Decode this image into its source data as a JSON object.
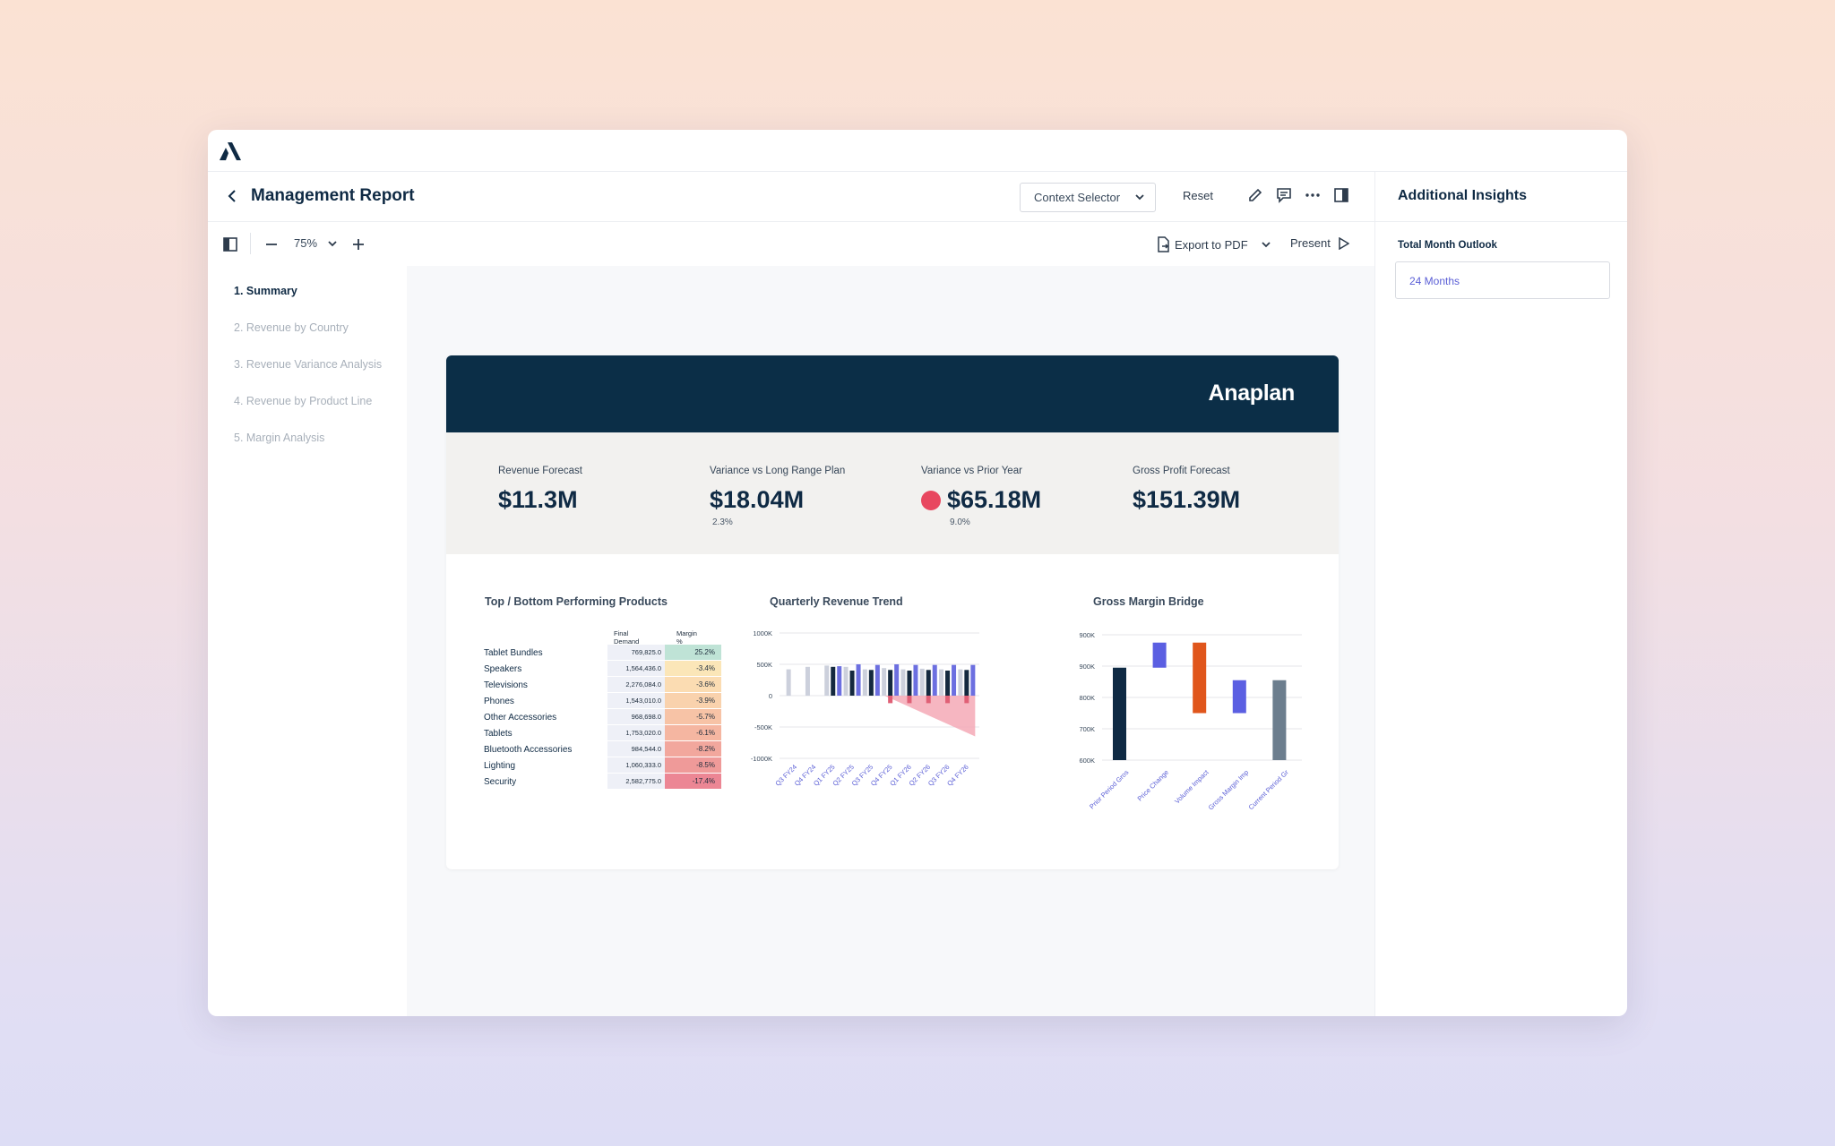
{
  "app": {
    "title": "Management Report"
  },
  "header": {
    "context_selector": "Context Selector",
    "reset": "Reset"
  },
  "toolbar": {
    "zoom": "75%",
    "export": "Export to PDF",
    "present": "Present"
  },
  "nav": {
    "items": [
      {
        "label": "1. Summary",
        "active": true
      },
      {
        "label": "2. Revenue by Country",
        "active": false
      },
      {
        "label": "3. Revenue Variance Analysis",
        "active": false
      },
      {
        "label": "4. Revenue by Product Line",
        "active": false
      },
      {
        "label": "5. Margin Analysis",
        "active": false
      }
    ]
  },
  "report": {
    "brand": "Anaplan",
    "kpis": [
      {
        "label": "Revenue Forecast",
        "value": "$11.3M",
        "sub": "",
        "indicator": false
      },
      {
        "label": "Variance vs Long Range Plan",
        "value": "$18.04M",
        "sub": "2.3%",
        "indicator": false
      },
      {
        "label": "Variance vs Prior Year",
        "value": "$65.18M",
        "sub": "9.0%",
        "indicator": true
      },
      {
        "label": "Gross Profit Forecast",
        "value": "$151.39M",
        "sub": "",
        "indicator": false
      }
    ],
    "products": {
      "title": "Top / Bottom Performing Products",
      "col_demand": "Final Demand",
      "col_margin": "Margin %",
      "rows": [
        {
          "name": "Tablet Bundles",
          "demand": "769,825.0",
          "margin": "25.2%",
          "color": "#bfe3d6"
        },
        {
          "name": "Speakers",
          "demand": "1,564,436.0",
          "margin": "-3.4%",
          "color": "#fbe6b8"
        },
        {
          "name": "Televisions",
          "demand": "2,276,084.0",
          "margin": "-3.6%",
          "color": "#fbdcb2"
        },
        {
          "name": "Phones",
          "demand": "1,543,010.0",
          "margin": "-3.9%",
          "color": "#f9d2ad"
        },
        {
          "name": "Other Accessories",
          "demand": "968,698.0",
          "margin": "-5.7%",
          "color": "#f7c3a6"
        },
        {
          "name": "Tablets",
          "demand": "1,753,020.0",
          "margin": "-6.1%",
          "color": "#f5b6a1"
        },
        {
          "name": "Bluetooth Accessories",
          "demand": "984,544.0",
          "margin": "-8.2%",
          "color": "#f2a79d"
        },
        {
          "name": "Lighting",
          "demand": "1,060,333.0",
          "margin": "-8.5%",
          "color": "#ef9a99"
        },
        {
          "name": "Security",
          "demand": "2,582,775.0",
          "margin": "-17.4%",
          "color": "#ec8694"
        }
      ]
    }
  },
  "side_panel": {
    "title": "Additional Insights",
    "field_label": "Total Month Outlook",
    "field_value": "24 Months"
  },
  "chart_data": [
    {
      "type": "bar",
      "title": "Quarterly Revenue Trend",
      "categories": [
        "Q3 FY24",
        "Q4 FY24",
        "Q1 FY25",
        "Q2 FY25",
        "Q3 FY25",
        "Q4 FY25",
        "Q1 FY26",
        "Q2 FY26",
        "Q3 FY26",
        "Q4 FY26"
      ],
      "yticks": [
        "1000K",
        "500K",
        "0",
        "-500K",
        "-1000K"
      ],
      "ylim": [
        -1000,
        1000
      ],
      "series": [
        {
          "values": [
            420,
            460,
            480,
            460,
            420,
            440,
            420,
            430,
            420,
            420
          ],
          "color": "#ccd0dc"
        },
        {
          "values": [
            null,
            null,
            460,
            400,
            410,
            410,
            400,
            410,
            400,
            410
          ],
          "color": "#14293f"
        },
        {
          "values": [
            null,
            null,
            470,
            500,
            490,
            500,
            490,
            490,
            490,
            490
          ],
          "color": "#6c6fe0"
        },
        {
          "values": [
            null,
            null,
            null,
            null,
            null,
            -120,
            -120,
            -120,
            -120,
            -120
          ],
          "color": "#e06076"
        }
      ],
      "variance_area": {
        "from_index": 5,
        "end_value": -650,
        "color": "#f4a9b6"
      }
    },
    {
      "type": "waterfall",
      "title": "Gross Margin Bridge",
      "categories": [
        "Prior Period Gros",
        "Price Change",
        "Volume Impact",
        "Gross Margin Imp",
        "Current Period Gr"
      ],
      "yticks": [
        "900K",
        "900K",
        "800K",
        "700K",
        "600K"
      ],
      "ylim": [
        600,
        1000
      ],
      "bars": [
        {
          "start": 600,
          "end": 895,
          "color": "#0f2a44"
        },
        {
          "start": 895,
          "end": 975,
          "color": "#5b5fe2"
        },
        {
          "start": 750,
          "end": 975,
          "color": "#e0561c"
        },
        {
          "start": 750,
          "end": 855,
          "color": "#5b5fe2"
        },
        {
          "start": 600,
          "end": 855,
          "color": "#6c7e8e"
        }
      ]
    }
  ]
}
